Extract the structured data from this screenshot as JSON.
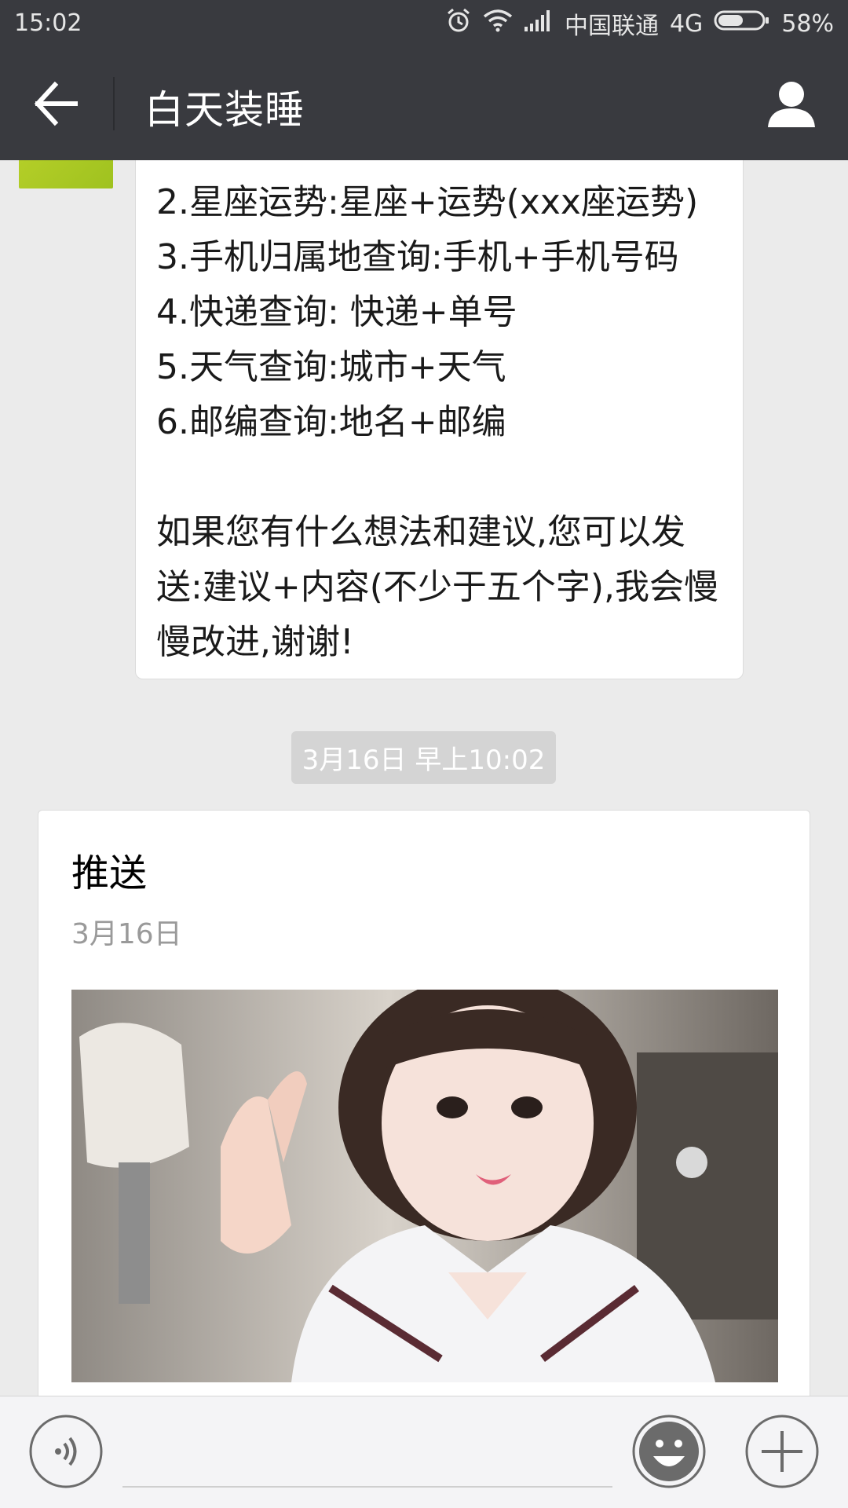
{
  "status_bar": {
    "time": "15:02",
    "carrier": "中国联通",
    "network": "4G",
    "battery": "58%",
    "battery_level": 0.58,
    "icons": [
      "alarm-icon",
      "wifi-icon",
      "signal-icon",
      "battery-icon"
    ]
  },
  "nav": {
    "title": "白天装睡",
    "back_icon": "arrow-left-icon",
    "profile_icon": "person-icon"
  },
  "messages": {
    "menu_text": "2.星座运势:星座+运势(xxx座运势)\n3.手机归属地查询:手机+手机号码\n4.快递查询: 快递+单号\n5.天气查询:城市+天气\n6.邮编查询:地名+邮编\n\n如果您有什么想法和建议,您可以发送:建议+内容(不少于五个字),我会慢慢改进,谢谢!",
    "timestamp": "3月16日 早上10:02",
    "article": {
      "title": "推送",
      "date": "3月16日"
    }
  },
  "input_bar": {
    "voice_icon": "voice-icon",
    "emoji_icon": "emoji-icon",
    "plus_icon": "plus-icon",
    "placeholder": ""
  },
  "colors": {
    "bar": "#393a3f",
    "chat_bg": "#ebebeb",
    "bubble": "#ffffff",
    "timestamp_bg": "#d4d4d4"
  }
}
